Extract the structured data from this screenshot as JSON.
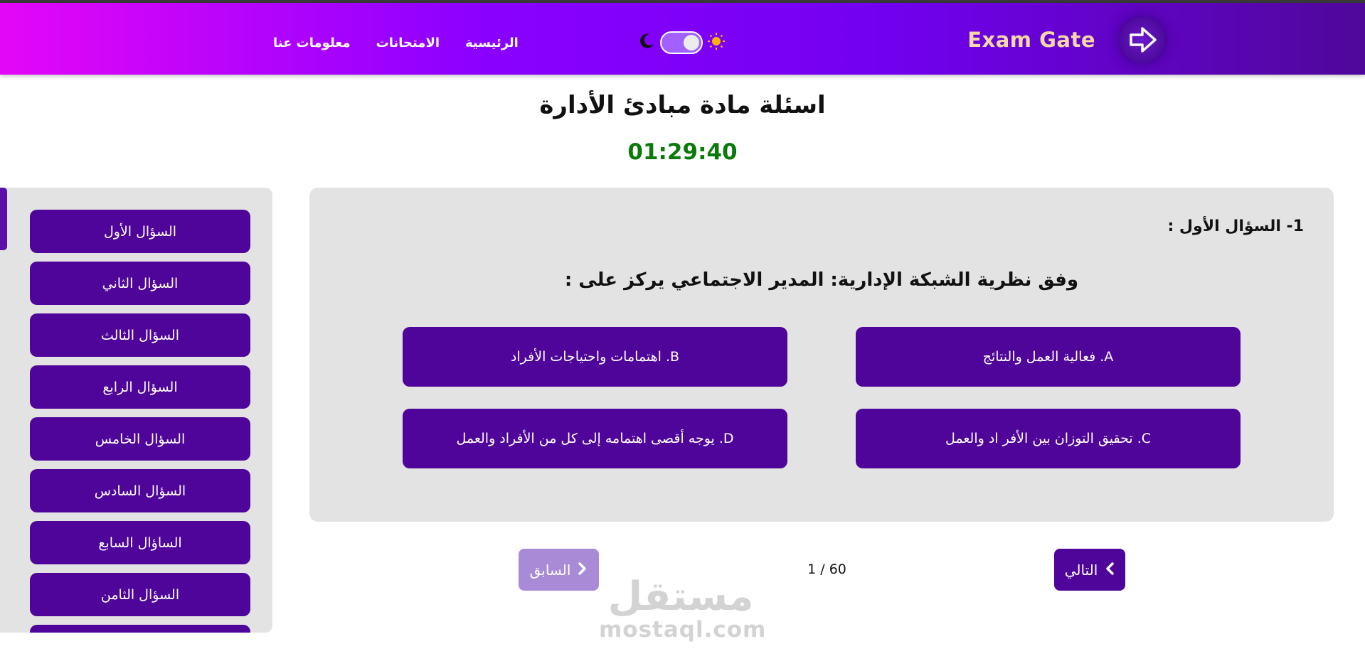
{
  "header": {
    "logo_text": "Exam Gate",
    "nav": [
      {
        "label": "الرئيسية"
      },
      {
        "label": "الامتحانات"
      },
      {
        "label": "معلومات عنا"
      }
    ],
    "theme_toggle": {
      "sun_icon": "sun-icon",
      "moon_icon": "moon-icon",
      "state": "light"
    }
  },
  "page": {
    "title": "اسئلة مادة مبادئ الأدارة",
    "timer": "01:29:40"
  },
  "sidebar": {
    "items": [
      {
        "label": "السؤال الأول"
      },
      {
        "label": "السؤال الثاني"
      },
      {
        "label": "السؤال الثالث"
      },
      {
        "label": "السؤال الرابع"
      },
      {
        "label": "السؤال الخامس"
      },
      {
        "label": "السؤال السادس"
      },
      {
        "label": "الساؤال السابع"
      },
      {
        "label": "السؤال الثامن"
      }
    ]
  },
  "question": {
    "number_label": "1- السؤال الأول :",
    "text": "وفق نظرية الشبكة الإدارية: المدير الاجتماعي يركز على :",
    "options": [
      {
        "label": "A. فعالية العمل والنتائج"
      },
      {
        "label": "B. اهتمامات واحتياجات الأفراد"
      },
      {
        "label": "C. تحقيق التوزان بين الأفر اد والعمل"
      },
      {
        "label": "D. يوجه أقصى اهتمامه إلى كل من الأفراد والعمل"
      }
    ]
  },
  "pager": {
    "next_label": "التالي",
    "prev_label": "السابق",
    "count": "1 / 60"
  },
  "watermark": {
    "arabic": "مستقل",
    "english": "mostaql.com"
  },
  "colors": {
    "primary": "#4f0599",
    "prev_disabled": "#a98ad6",
    "timer": "#0a7a0a",
    "card_bg": "#e3e3e3",
    "logo_text": "#f5d7a8"
  }
}
